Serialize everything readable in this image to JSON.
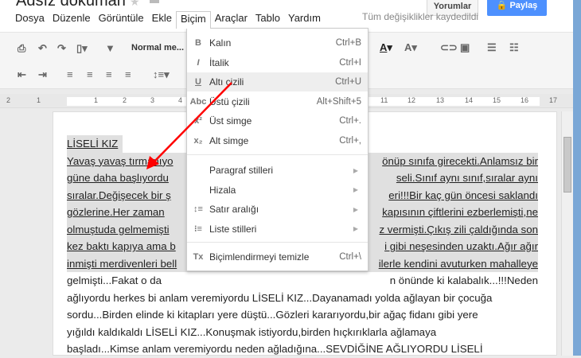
{
  "header": {
    "title": "Adsız doküman",
    "comments_label": "Yorumlar",
    "share_label": "Paylaş",
    "saved_status": "Tüm değişiklikler kaydedildi"
  },
  "menubar": [
    "Dosya",
    "Düzenle",
    "Görüntüle",
    "Ekle",
    "Biçim",
    "Araçlar",
    "Tablo",
    "Yardım"
  ],
  "toolbar": {
    "style_select": "Normal me..."
  },
  "ruler": [
    "2",
    "1",
    "1",
    "2",
    "3",
    "4",
    "11",
    "12",
    "13",
    "14",
    "15",
    "16",
    "17"
  ],
  "format_menu": {
    "items": [
      {
        "icon": "bold-icon",
        "glyph": "B",
        "label": "Kalın",
        "shortcut": "Ctrl+B"
      },
      {
        "icon": "italic-icon",
        "glyph": "I",
        "label": "İtalik",
        "shortcut": "Ctrl+I"
      },
      {
        "icon": "underline-icon",
        "glyph": "U",
        "label": "Altı çizili",
        "shortcut": "Ctrl+U",
        "highlighted": true
      },
      {
        "icon": "strikethrough-icon",
        "glyph": "Abc",
        "label": "Üstü çizili",
        "shortcut": "Alt+Shift+5"
      },
      {
        "icon": "superscript-icon",
        "glyph": "x²",
        "label": "Üst simge",
        "shortcut": "Ctrl+."
      },
      {
        "icon": "subscript-icon",
        "glyph": "x₂",
        "label": "Alt simge",
        "shortcut": "Ctrl+,"
      }
    ],
    "submenus": [
      {
        "icon": "",
        "glyph": "",
        "label": "Paragraf stilleri"
      },
      {
        "icon": "",
        "glyph": "",
        "label": "Hizala"
      },
      {
        "icon": "line-spacing-icon",
        "glyph": "↕≡",
        "label": "Satır aralığı"
      },
      {
        "icon": "list-icon",
        "glyph": "⁝≡",
        "label": "Liste stilleri"
      }
    ],
    "clear": {
      "icon": "clear-formatting-icon",
      "glyph": "Tx",
      "label": "Biçimlendirmeyi temizle",
      "shortcut": "Ctrl+\\"
    }
  },
  "document": {
    "heading": "LİSELİ KIZ",
    "selected_lines": [
      [
        "Yavaş yavaş tırmanıyo",
        "önüp sınıfa girecekti.Anlamsız bir"
      ],
      [
        "güne daha başlıyordu",
        "seli.Sınıf aynı sınıf,sıralar aynı"
      ],
      [
        "sıralar.Değişecek bir ş",
        "eri!!!Bir kaç gün öncesi saklandı"
      ],
      [
        "gözlerine.Her zaman",
        "kapısının çiftlerini ezberlemişti,ne"
      ],
      [
        "olmuştuda gelmemişti",
        "z vermişti.Çıkış zili çaldığında son"
      ],
      [
        "kez baktı kapıya ama b",
        "i gibi neşesinden uzaktı.Ağır ağır"
      ],
      [
        "inmişti merdivenleri bell",
        "ilerle kendini avuturken mahalleye"
      ]
    ],
    "lines": [
      [
        "gelmişti...Fakat o da",
        "n önünde ki kalabalık...!!!Neden"
      ],
      [
        "ağlıyordu herkes bi anlam veremiyordu LİSELİ KIZ...Dayanamadı yolda ağlayan bir çocuğa",
        ""
      ],
      [
        "sordu...Birden elinde ki kitapları yere düştü...Gözleri kararıyordu,bir ağaç fidanı gibi yere",
        ""
      ],
      [
        "yığıldı kaldıkaldı LİSELİ KIZ...Konuşmak istiyordu,birden hıçkırıklarla ağlamaya",
        ""
      ],
      [
        "başladı...Kimse anlam veremiyordu neden ağladığına...SEVDİĞİNE AĞLIYORDU LİSELİ",
        ""
      ]
    ]
  },
  "colors": {
    "accent": "#4d90fe",
    "annotation_arrow": "#ff0000",
    "selection": "#e0e0e0"
  }
}
